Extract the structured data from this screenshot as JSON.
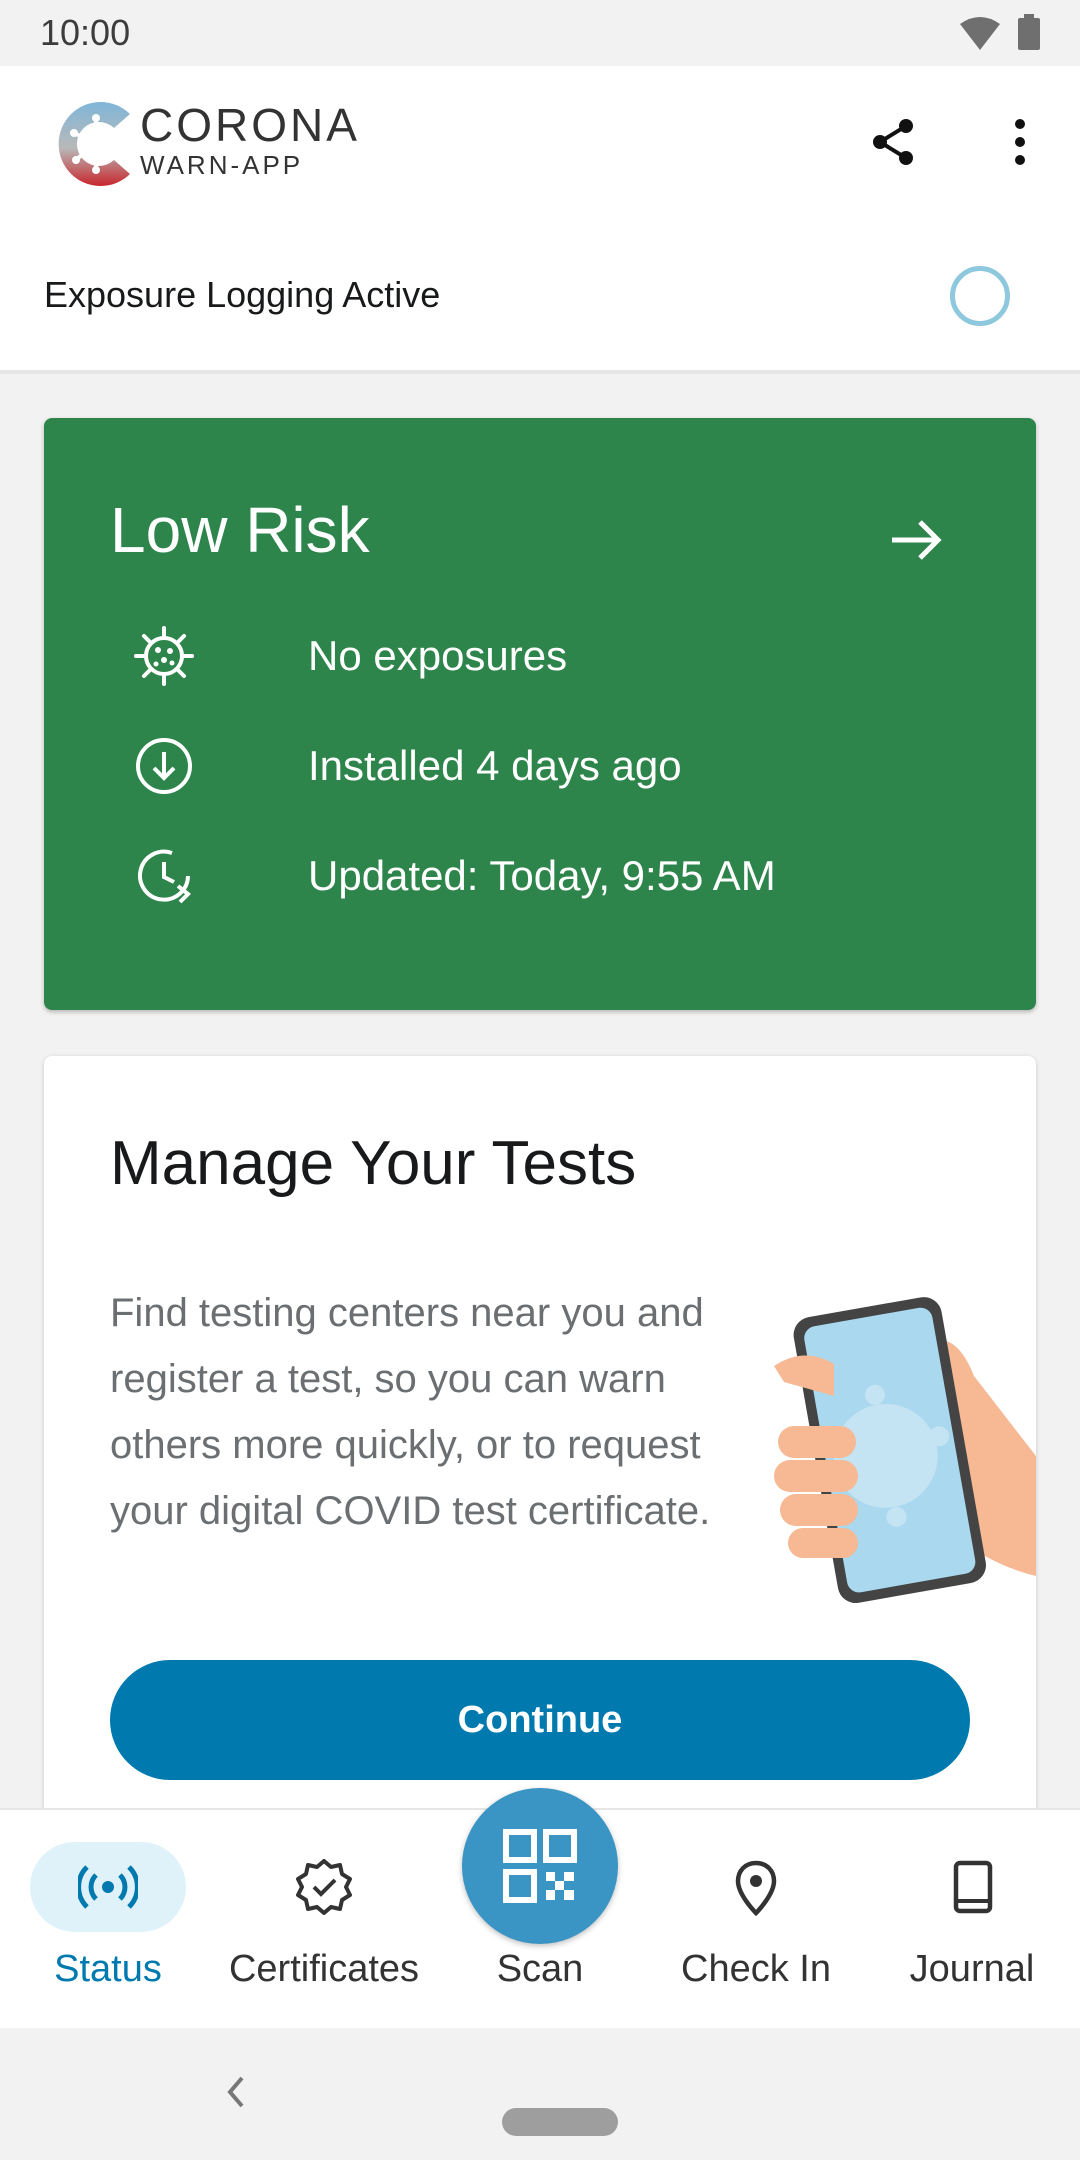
{
  "status_bar": {
    "time": "10:00",
    "wifi_icon": "wifi-icon",
    "battery_icon": "battery-icon"
  },
  "header": {
    "logo_title": "CORONA",
    "logo_subtitle": "WARN-APP",
    "share_icon": "share-icon",
    "more_icon": "more-vert-icon",
    "exposure_logging": "Exposure Logging Active"
  },
  "risk_card": {
    "title": "Low Risk",
    "color": "#2e854b",
    "items": [
      {
        "icon": "virus-icon",
        "text": "No exposures"
      },
      {
        "icon": "download-icon",
        "text": "Installed 4 days ago"
      },
      {
        "icon": "update-clock-icon",
        "text": "Updated: Today, 9:55 AM"
      }
    ]
  },
  "tests_card": {
    "title": "Manage Your Tests",
    "body": "Find testing centers near you and register a test, so you can warn others more quickly, or to request your digital COVID test certificate.",
    "button": "Continue",
    "button_color": "#0079ae"
  },
  "bottom_nav": {
    "items": [
      {
        "label": "Status",
        "icon": "status-broadcast-icon",
        "active": true
      },
      {
        "label": "Certificates",
        "icon": "certificate-badge-icon",
        "active": false
      },
      {
        "label": "Scan",
        "icon": "qr-code-icon",
        "active": false
      },
      {
        "label": "Check In",
        "icon": "location-pin-icon",
        "active": false
      },
      {
        "label": "Journal",
        "icon": "journal-book-icon",
        "active": false
      }
    ]
  }
}
